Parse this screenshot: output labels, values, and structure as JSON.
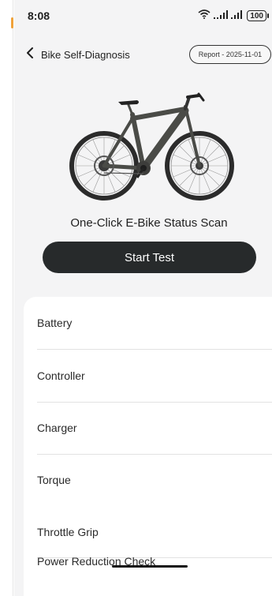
{
  "status_bar": {
    "time": "8:08",
    "battery_level": "100",
    "icons": [
      "wifi-icon",
      "signal-icon",
      "signal-icon",
      "battery-icon"
    ]
  },
  "header": {
    "title": "Bike Self-Diagnosis",
    "report_label": "Report - 2025-11-01",
    "back_icon": "chevron-left-icon"
  },
  "scan": {
    "caption": "One-Click E-Bike Status Scan",
    "start_label": "Start Test"
  },
  "checks": {
    "items": [
      {
        "label": "Battery"
      },
      {
        "label": "Controller"
      },
      {
        "label": "Charger"
      },
      {
        "label": "Torque"
      },
      {
        "label": "Throttle Grip"
      },
      {
        "label": "Power Reduction Check"
      }
    ]
  },
  "colors": {
    "background": "#f4f4f5",
    "button": "#272a2b",
    "card": "#ffffff",
    "accent_edge": "#f0a23a"
  }
}
